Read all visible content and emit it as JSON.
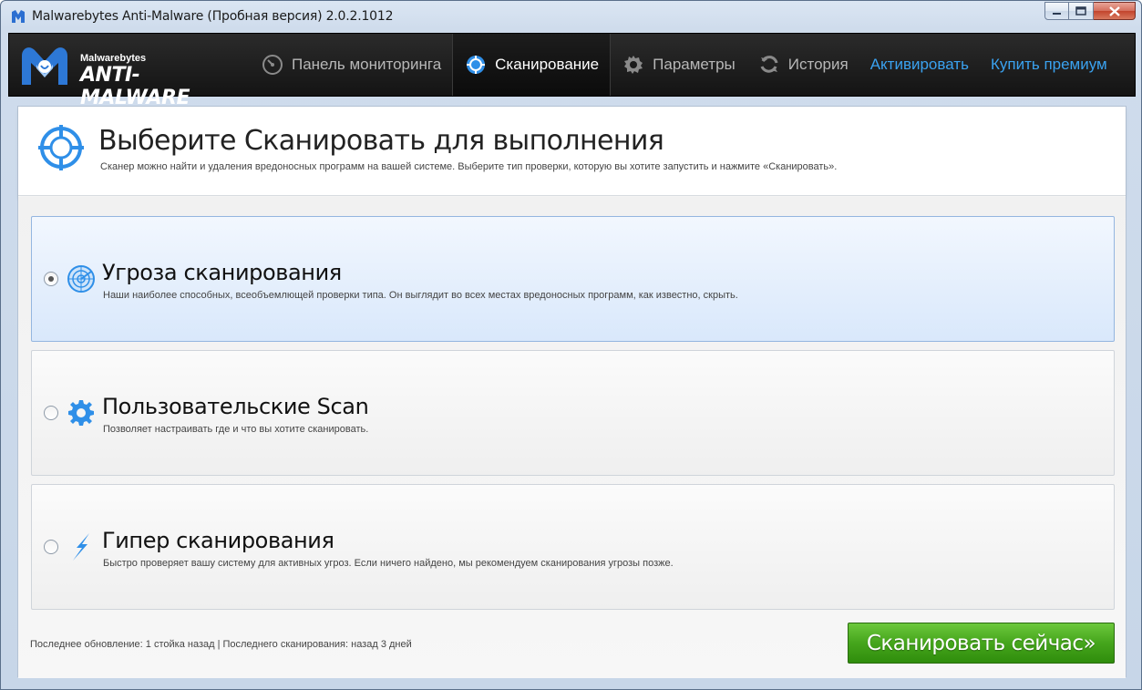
{
  "window": {
    "title": "Malwarebytes Anti-Malware (Пробная версия)  2.0.2.1012"
  },
  "logo": {
    "small": "Malwarebytes",
    "big": "ANTI-MALWARE"
  },
  "nav": {
    "items": [
      {
        "label": "Панель мониторинга",
        "icon": "dashboard-icon"
      },
      {
        "label": "Сканирование",
        "icon": "scan-target-icon"
      },
      {
        "label": "Параметры",
        "icon": "gear-icon"
      },
      {
        "label": "История",
        "icon": "history-icon"
      }
    ],
    "activate": "Активировать",
    "buy": "Купить премиум",
    "active_index": 1
  },
  "page": {
    "title": "Выберите Сканировать для выполнения",
    "subtitle": "Сканер можно найти и удаления вредоносных программ на вашей системе. Выберите тип проверки, которую вы хотите запустить и нажмите «Сканировать»."
  },
  "options": [
    {
      "title": "Угроза сканирования",
      "desc": "Наши наиболее способных, всеобъемлющей проверки типа. Он выглядит во всех местах вредоносных программ, как известно, скрыть.",
      "icon": "radar-icon",
      "selected": true
    },
    {
      "title": "Пользовательские Scan",
      "desc": "Позволяет настраивать где и что вы хотите сканировать.",
      "icon": "gear-icon",
      "selected": false
    },
    {
      "title": "Гипер сканирования",
      "desc": "Быстро проверяет вашу систему для активных угроз. Если ничего найдено, мы рекомендуем сканирования угрозы позже.",
      "icon": "lightning-icon",
      "selected": false
    }
  ],
  "status": "Последнее обновление: 1 стойка назад | Последнего сканирования: назад 3 дней",
  "scan_button": "Сканировать сейчас»",
  "colors": {
    "accent_blue": "#3aa2f0",
    "scan_green": "#45a51c",
    "header_dark": "#1a1a1a"
  }
}
